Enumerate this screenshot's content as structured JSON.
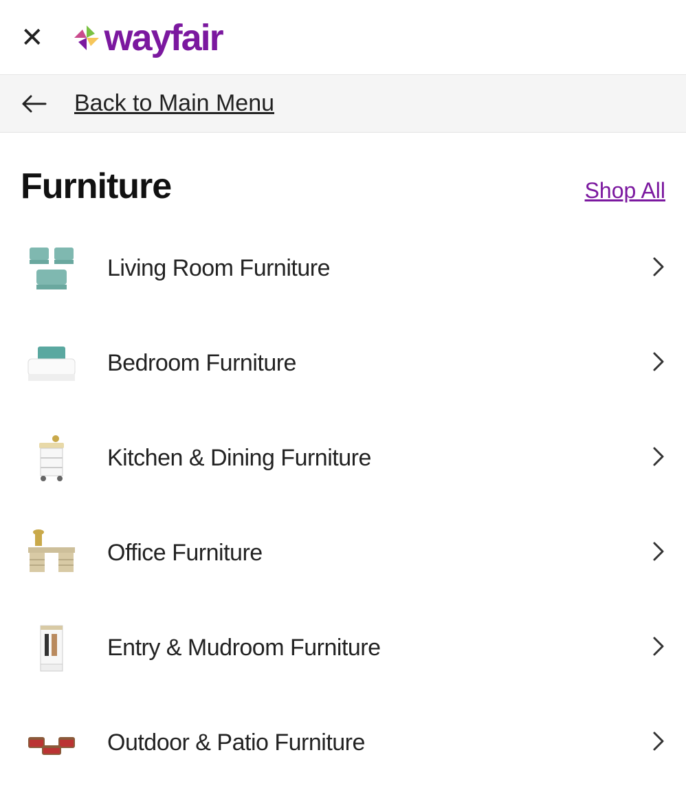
{
  "brand": "wayfair",
  "nav": {
    "back_label": "Back to Main Menu"
  },
  "page": {
    "title": "Furniture",
    "shop_all": "Shop All"
  },
  "list": {
    "items": [
      {
        "id": "living-room",
        "label": "Living Room Furniture",
        "icon": "sofa-chairs-icon"
      },
      {
        "id": "bedroom",
        "label": "Bedroom Furniture",
        "icon": "bed-icon"
      },
      {
        "id": "kitchen-dining",
        "label": "Kitchen & Dining Furniture",
        "icon": "kitchen-cart-icon"
      },
      {
        "id": "office",
        "label": "Office Furniture",
        "icon": "desk-icon"
      },
      {
        "id": "entry-mudroom",
        "label": "Entry & Mudroom Furniture",
        "icon": "hall-tree-icon"
      },
      {
        "id": "outdoor-patio",
        "label": "Outdoor & Patio Furniture",
        "icon": "patio-set-icon"
      }
    ]
  }
}
